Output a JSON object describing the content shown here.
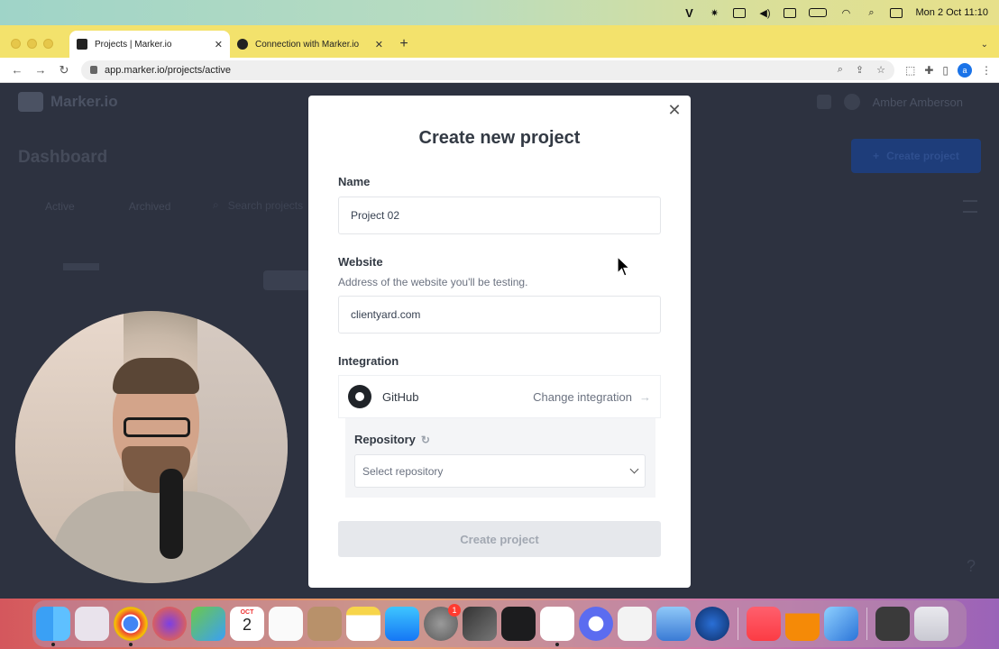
{
  "menubar": {
    "clock": "Mon 2 Oct  11:10",
    "icons": [
      "apple-icon",
      "vimeo-icon",
      "gear-icon",
      "screen-record-icon",
      "volume-icon",
      "vpn-icon",
      "battery-icon",
      "wifi-icon",
      "search-icon",
      "control-center-icon"
    ]
  },
  "browser": {
    "tabs": [
      {
        "title": "Projects | Marker.io",
        "icon": "marker-icon",
        "active": true
      },
      {
        "title": "Connection with Marker.io",
        "icon": "github-icon",
        "active": false
      }
    ],
    "url": "app.marker.io/projects/active",
    "profile_initial": "a"
  },
  "background_app": {
    "logo": "Marker.io",
    "user_name": "Amber Amberson",
    "page_title": "Dashboard",
    "create_button": "Create project",
    "filters": [
      "Active",
      "Archived"
    ],
    "search_placeholder": "Search projects"
  },
  "modal": {
    "title": "Create new project",
    "name": {
      "label": "Name",
      "value": "Project 02"
    },
    "website": {
      "label": "Website",
      "help": "Address of the website you'll be testing.",
      "value": "clientyard.com"
    },
    "integration": {
      "label": "Integration",
      "provider": "GitHub",
      "change_label": "Change integration"
    },
    "repository": {
      "label": "Repository",
      "placeholder": "Select repository"
    },
    "submit_label": "Create project"
  },
  "dock": {
    "calendar_month": "OCT",
    "calendar_day": "2",
    "settings_badge": "1"
  }
}
